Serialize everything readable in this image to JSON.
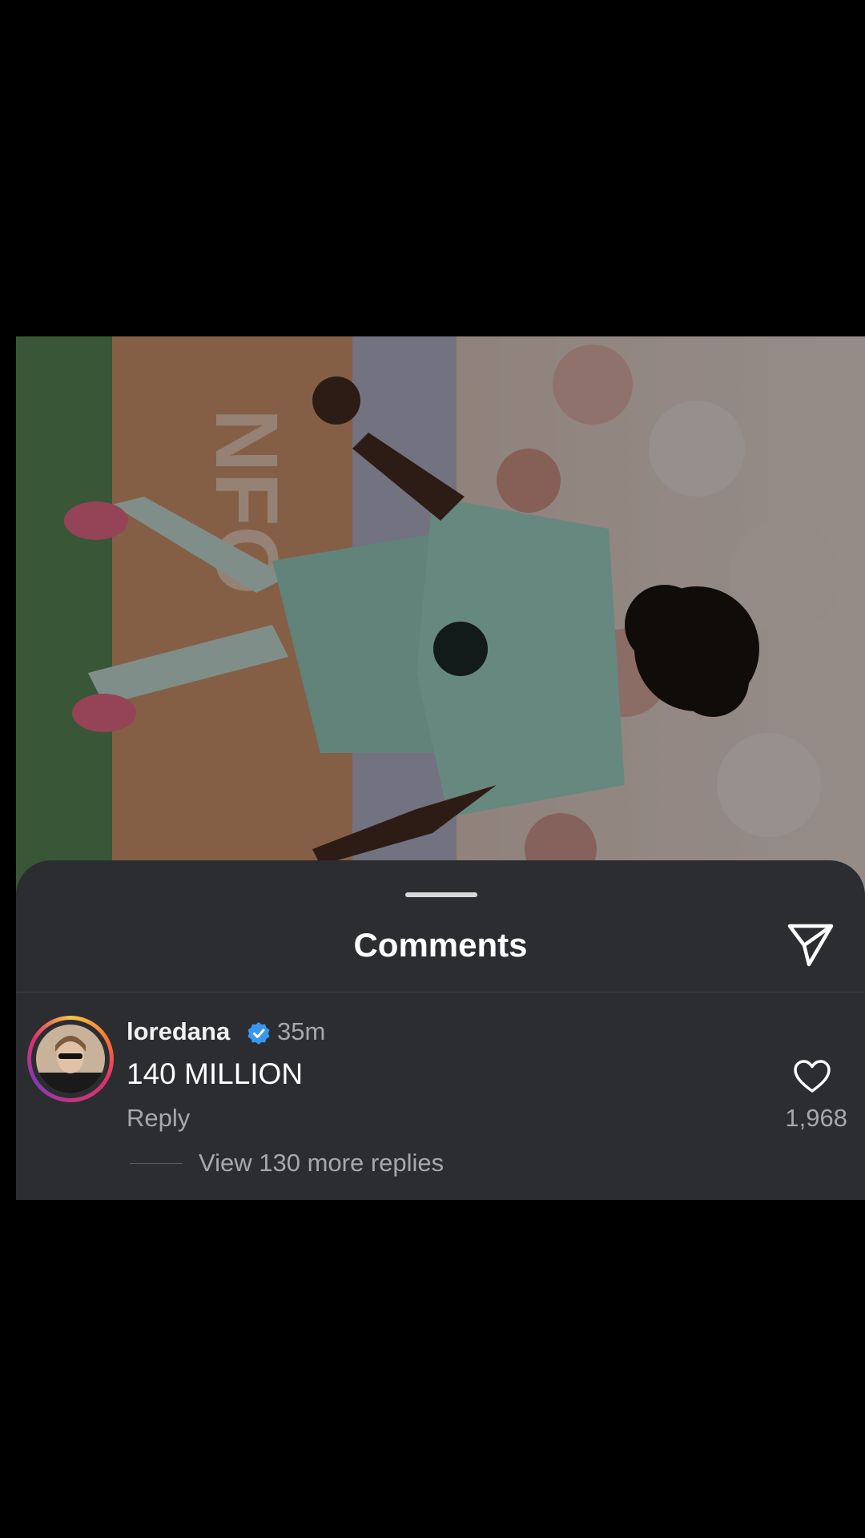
{
  "sheet": {
    "title": "Comments"
  },
  "comment": {
    "username": "loredana",
    "verified": true,
    "time": "35m",
    "text": "140 MILLION",
    "reply_label": "Reply",
    "like_count": "1,968",
    "view_replies": "View 130 more replies"
  },
  "icons": {
    "share": "paper-plane-icon",
    "verified": "verified-badge-icon",
    "like": "heart-outline-icon"
  },
  "colors": {
    "sheet_background": "#2b2d31",
    "verified_blue": "#3897f0",
    "secondary_text": "#a8a8a8"
  }
}
